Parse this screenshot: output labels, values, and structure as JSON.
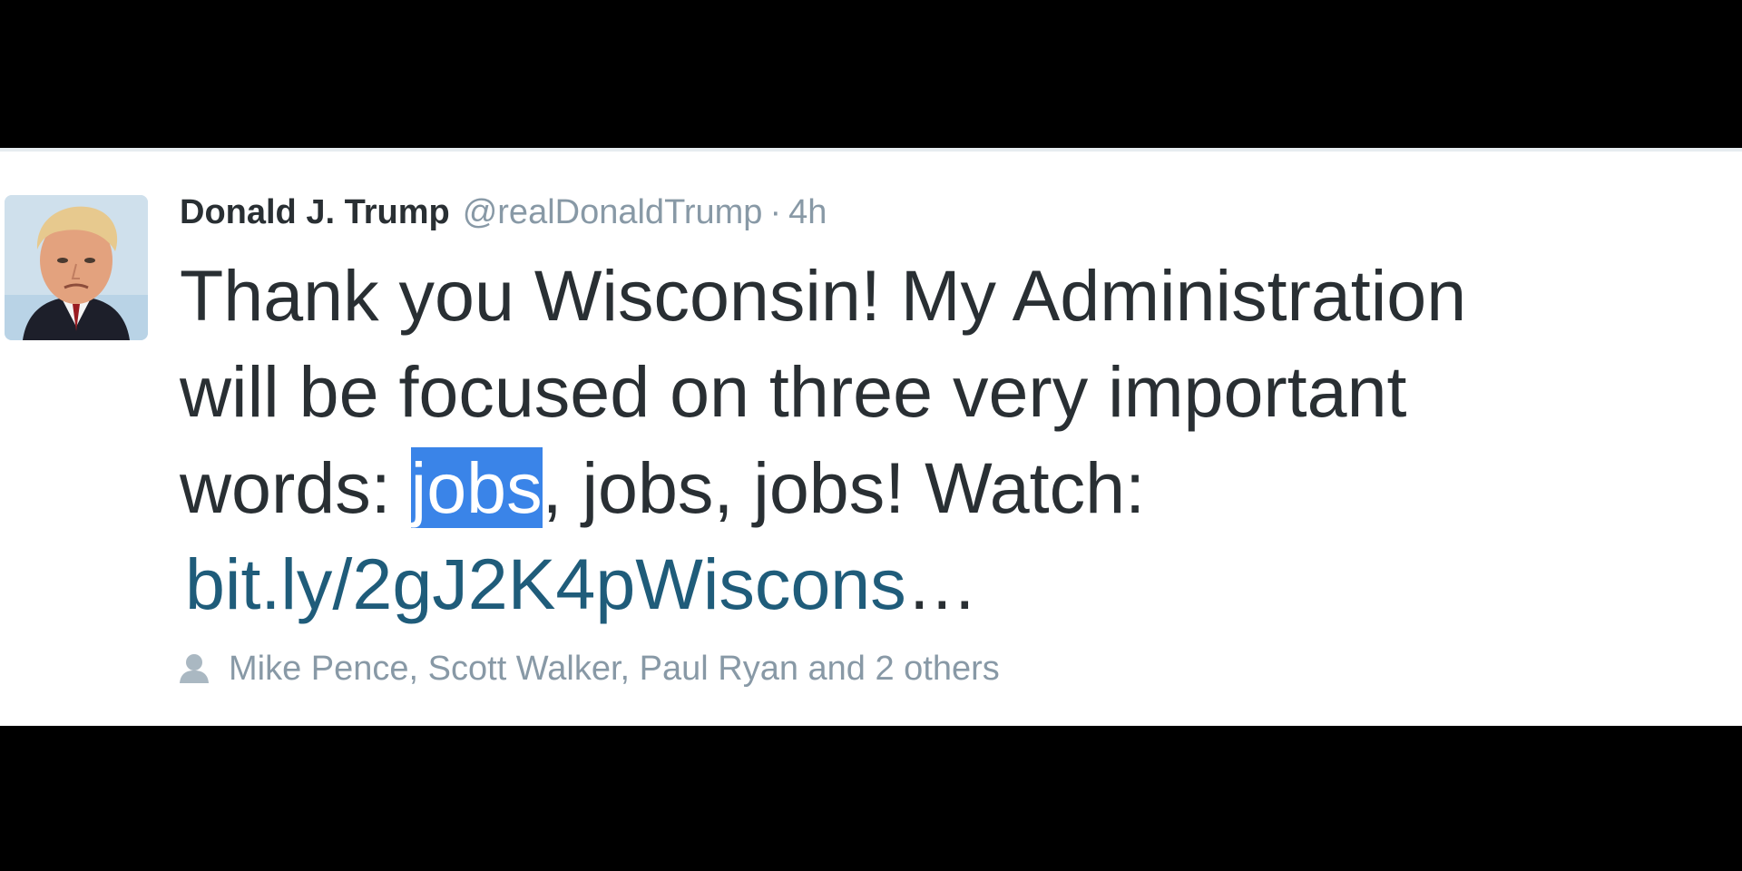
{
  "tweet": {
    "display_name": "Donald J. Trump",
    "handle": "@realDonaldTrump",
    "separator": "·",
    "timestamp": "4h",
    "text_line1": "Thank you Wisconsin! My Administration",
    "text_line2": "will be focused on three very important",
    "text_line3_prefix": "words: ",
    "text_line3_highlight": "jobs",
    "text_line3_suffix": ", jobs, jobs! Watch:",
    "link_text": "bit.ly/2gJ2K4pWiscons",
    "link_ellipsis": "…",
    "likers_text": "Mike Pence, Scott Walker, Paul Ryan and 2 others"
  },
  "icons": {
    "avatar": "profile-photo",
    "likers": "person-icon"
  },
  "colors": {
    "text": "#292f33",
    "muted": "#8899a6",
    "link": "#1f5c7a",
    "selection": "#3a84e8",
    "letterbox": "#000000"
  }
}
